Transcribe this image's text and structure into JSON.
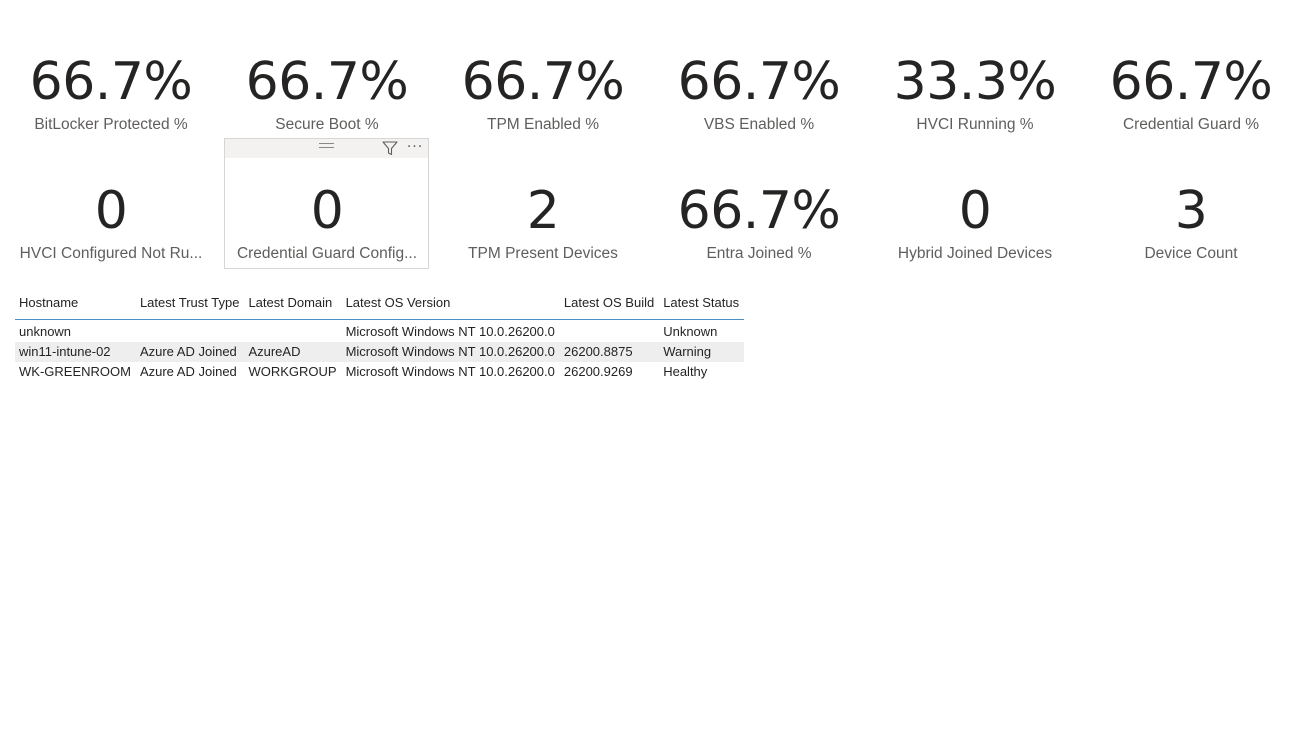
{
  "kpi_cards": [
    {
      "value": "66.7%",
      "label": "BitLocker Protected %"
    },
    {
      "value": "66.7%",
      "label": "Secure Boot %"
    },
    {
      "value": "66.7%",
      "label": "TPM Enabled %"
    },
    {
      "value": "66.7%",
      "label": "VBS Enabled %"
    },
    {
      "value": "33.3%",
      "label": "HVCI Running %"
    },
    {
      "value": "66.7%",
      "label": "Credential Guard %"
    },
    {
      "value": "0",
      "label": "HVCI Configured Not Ru..."
    },
    {
      "value": "0",
      "label": "Credential Guard Config..."
    },
    {
      "value": "2",
      "label": "TPM Present Devices"
    },
    {
      "value": "66.7%",
      "label": "Entra Joined %"
    },
    {
      "value": "0",
      "label": "Hybrid Joined Devices"
    },
    {
      "value": "3",
      "label": "Device Count"
    }
  ],
  "visual_header": {
    "filter_icon": "filter-icon",
    "more_icon": "more-options-icon",
    "more_glyph": "···"
  },
  "table": {
    "columns": [
      "Hostname",
      "Latest Trust Type",
      "Latest Domain",
      "Latest OS Version",
      "Latest OS Build",
      "Latest Status"
    ],
    "rows": [
      [
        "unknown",
        "",
        "",
        "Microsoft Windows NT 10.0.26200.0",
        "",
        "Unknown"
      ],
      [
        "win11-intune-02",
        "Azure AD Joined",
        "AzureAD",
        "Microsoft Windows NT 10.0.26200.0",
        "26200.8875",
        "Warning"
      ],
      [
        "WK-GREENROOM",
        "Azure AD Joined",
        "WORKGROUP",
        "Microsoft Windows NT 10.0.26200.0",
        "26200.9269",
        "Healthy"
      ]
    ]
  },
  "colors": {
    "header_border": "#4a90c8",
    "alt_row": "#eeeeee",
    "value_text": "#252423",
    "label_text": "#605e5c"
  }
}
